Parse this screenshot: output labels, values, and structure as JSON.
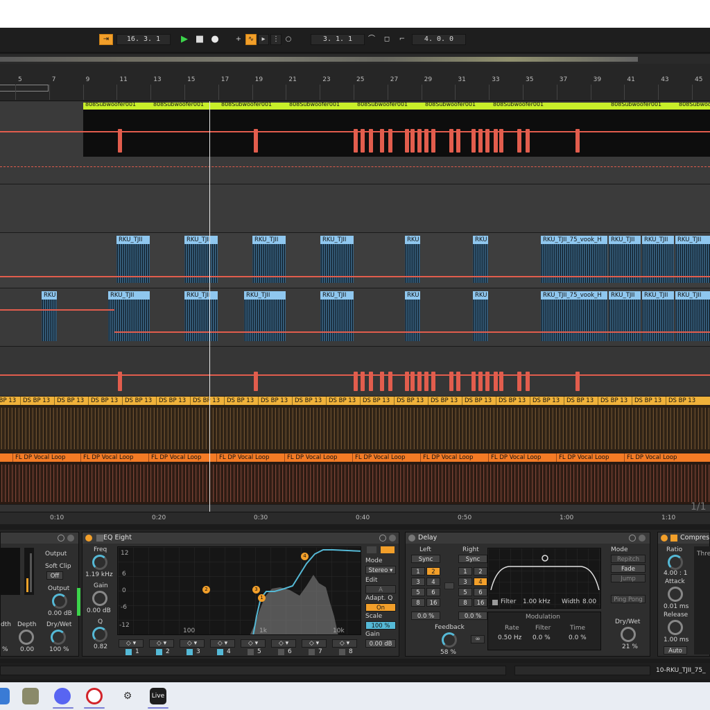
{
  "transport": {
    "arrangement_position": "16.  3.  1",
    "loop_start": "3.  1.  1",
    "loop_length": "4.  0.  0",
    "follow_icon": "follow-icon",
    "add_label": "+"
  },
  "ruler": {
    "bars": [
      "5",
      "7",
      "9",
      "11",
      "13",
      "15",
      "17",
      "19",
      "21",
      "23",
      "25",
      "27",
      "29",
      "31",
      "33",
      "35",
      "37",
      "39",
      "41",
      "43",
      "45"
    ]
  },
  "tracks": {
    "sub_clip_name": "808Subwoofer001",
    "vocal_clip_short": "RKU_TJII",
    "vocal_clip_tiny": "RKU",
    "vocal_clip_long": "RKU_TJII_75_vook_H",
    "drum_clip": "DS  BP  13",
    "vocal_loop_clip": "FL  DP  Vocal  Loop"
  },
  "time_ruler": {
    "labels": [
      "0:10",
      "0:20",
      "0:30",
      "0:40",
      "0:50",
      "1:00",
      "1:10"
    ],
    "zoom_hint": "1/1"
  },
  "devices": {
    "left_device": {
      "output_label": "Output",
      "soft_clip_label": "Soft Clip",
      "soft_clip_value": "Off",
      "output_knob_label": "Output",
      "output_value": "0.00 dB",
      "width_label": "dth",
      "width_value": "%",
      "depth_label": "Depth",
      "depth_value": "0.00",
      "drywet_label": "Dry/Wet",
      "drywet_value": "100 %"
    },
    "eq_eight": {
      "title": "EQ Eight",
      "freq_label": "Freq",
      "freq_value": "1.19 kHz",
      "gain_label": "Gain",
      "gain_value": "0.00 dB",
      "q_label": "Q",
      "q_value": "0.82",
      "db_scale": [
        "12",
        "6",
        "0",
        "-6",
        "-12"
      ],
      "freq_scale": [
        "100",
        "1k",
        "10k"
      ],
      "mode_label": "Mode",
      "mode_value": "Stereo ▾",
      "edit_label": "Edit",
      "edit_value": "A",
      "adapt_q_label": "Adapt. Q",
      "adapt_q_value": "On",
      "scale_label": "Scale",
      "scale_value": "100 %",
      "gain_out_label": "Gain",
      "gain_out_value": "0.00 dB",
      "bands": [
        "1",
        "2",
        "3",
        "4",
        "5",
        "6",
        "7",
        "8"
      ],
      "band_points": [
        "1",
        "2",
        "3",
        "4"
      ]
    },
    "delay": {
      "title": "Delay",
      "left_label": "Left",
      "right_label": "Right",
      "sync_label": "Sync",
      "left_values": [
        "1",
        "2",
        "3",
        "4",
        "5",
        "6",
        "8",
        "16"
      ],
      "right_values": [
        "1",
        "2",
        "3",
        "4",
        "5",
        "6",
        "8",
        "16"
      ],
      "left_offset": "0.0 %",
      "right_offset": "0.0 %",
      "filter_label": "Filter",
      "filter_value": "1.00 kHz",
      "width_label": "Width",
      "width_value": "8.00",
      "feedback_label": "Feedback",
      "feedback_value": "58 %",
      "modulation_label": "Modulation",
      "rate_label": "Rate",
      "rate_value": "0.50 Hz",
      "filter_mod_label": "Filter",
      "filter_mod_value": "0.0 %",
      "time_label": "Time",
      "time_value": "0.0 %",
      "mode_label": "Mode",
      "repitch_label": "Repitch",
      "fade_label": "Fade",
      "jump_label": "Jump",
      "pingpong_label": "Ping Pong",
      "drywet_label": "Dry/Wet",
      "drywet_value": "21 %"
    },
    "compressor": {
      "title": "Compres",
      "ratio_label": "Ratio",
      "ratio_value": "4.00 : 1",
      "attack_label": "Attack",
      "attack_value": "0.01 ms",
      "release_label": "Release",
      "release_value": "1.00 ms",
      "auto_label": "Auto",
      "thresh_label": "Thre"
    }
  },
  "status": {
    "selected_clip": "10-RKU_TJII_75_"
  },
  "taskbar": {
    "apps": [
      "file-explorer-icon",
      "notepad-icon",
      "discord-icon",
      "opera-icon",
      "steam-icon",
      "ableton-live-icon"
    ],
    "live_label": "Live"
  },
  "colors": {
    "accent": "#f29f2a",
    "automation": "#e25d4d",
    "sub_track": "#c8ef2a",
    "vocal_clip": "#8fc7ef",
    "drum_track": "#f0b23a",
    "vocal_loop_track": "#f47b25",
    "eq_curve": "#55b9d6"
  }
}
